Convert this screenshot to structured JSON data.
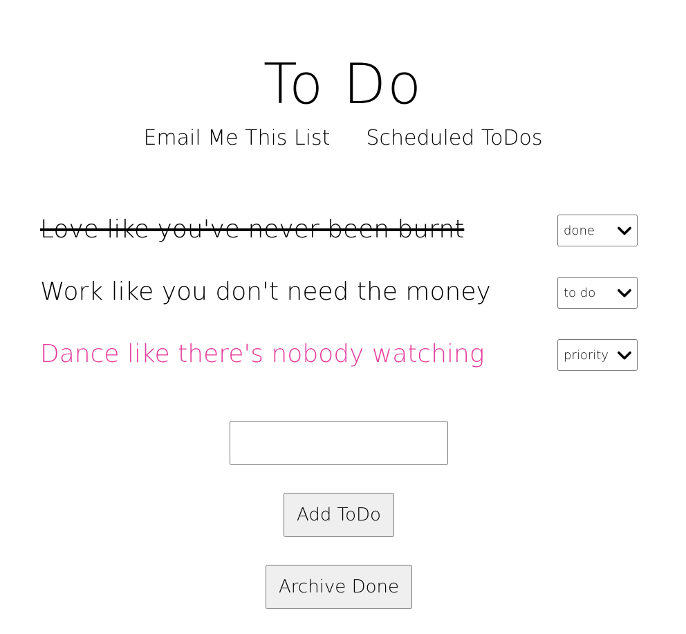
{
  "page": {
    "title": "To Do"
  },
  "nav": {
    "email_link": "Email Me This List",
    "scheduled_link": "Scheduled ToDos"
  },
  "todos": [
    {
      "text": "Love like you've never been burnt",
      "status": "done"
    },
    {
      "text": "Work like you don't need the money",
      "status": "to do"
    },
    {
      "text": "Dance like there's nobody watching",
      "status": "priority"
    }
  ],
  "colors": {
    "priority": "#e63d9c",
    "done": "#000000",
    "todo": "#000000"
  },
  "form": {
    "new_todo_value": "",
    "add_button": "Add ToDo",
    "archive_button": "Archive Done"
  },
  "icons": {
    "select_arrow": "chevron-down-icon"
  }
}
